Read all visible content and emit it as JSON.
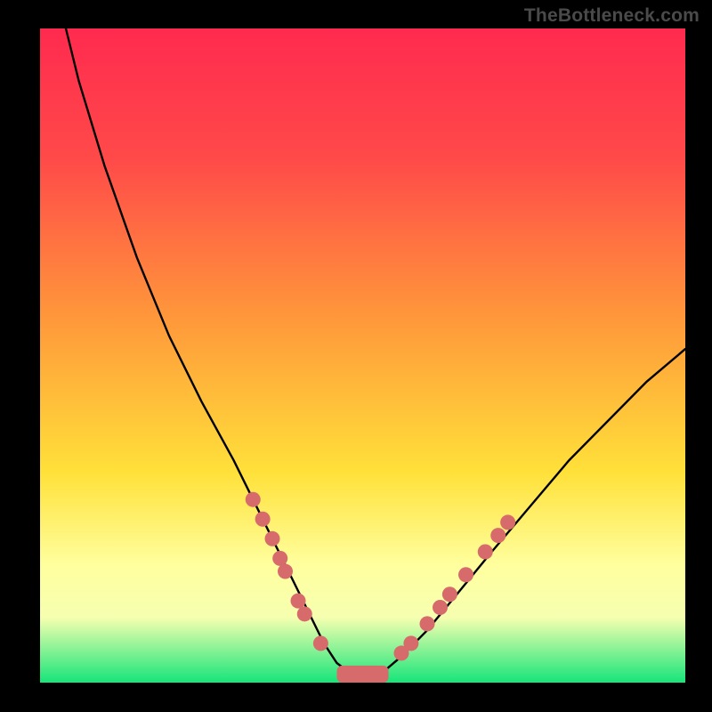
{
  "watermark": "TheBottleneck.com",
  "colors": {
    "top": "#ff2a4f",
    "redmid": "#ff4a49",
    "orange": "#ff9a3a",
    "yellow": "#ffe13a",
    "pale": "#ffff9e",
    "pale2": "#f6ffb0",
    "green": "#17e57a",
    "curve": "#000000",
    "marker": "#d76a6a",
    "marker_stroke": "#c55a5a"
  },
  "chart_data": {
    "type": "line",
    "title": "",
    "xlabel": "",
    "ylabel": "",
    "xlim": [
      0,
      100
    ],
    "ylim": [
      0,
      100
    ],
    "series": [
      {
        "name": "curve",
        "x": [
          4,
          6,
          10,
          15,
          20,
          25,
          30,
          33,
          36,
          39,
          42,
          44,
          46,
          48,
          50,
          53,
          56,
          60,
          65,
          70,
          76,
          82,
          88,
          94,
          100
        ],
        "y": [
          100,
          92,
          79,
          65,
          53,
          43,
          34,
          28,
          22,
          16,
          10,
          6,
          3,
          1.5,
          1,
          1.5,
          4,
          8,
          14,
          20,
          27,
          34,
          40,
          46,
          51
        ]
      }
    ],
    "markers_left": [
      {
        "x": 33.0,
        "y": 28.0
      },
      {
        "x": 34.5,
        "y": 25.0
      },
      {
        "x": 36.0,
        "y": 22.0
      },
      {
        "x": 37.2,
        "y": 19.0
      },
      {
        "x": 38.0,
        "y": 17.0
      },
      {
        "x": 40.0,
        "y": 12.5
      },
      {
        "x": 41.0,
        "y": 10.5
      },
      {
        "x": 43.5,
        "y": 6.0
      }
    ],
    "markers_right": [
      {
        "x": 56.0,
        "y": 4.5
      },
      {
        "x": 57.5,
        "y": 6.0
      },
      {
        "x": 60.0,
        "y": 9.0
      },
      {
        "x": 62.0,
        "y": 11.5
      },
      {
        "x": 63.5,
        "y": 13.5
      },
      {
        "x": 66.0,
        "y": 16.5
      },
      {
        "x": 69.0,
        "y": 20.0
      },
      {
        "x": 71.0,
        "y": 22.5
      },
      {
        "x": 72.5,
        "y": 24.5
      }
    ],
    "plateau": {
      "x0": 46,
      "x1": 54,
      "y": 1.3,
      "thickness": 2.6
    }
  }
}
